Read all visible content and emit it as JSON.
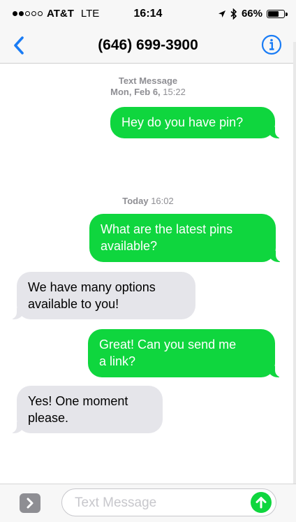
{
  "status_bar": {
    "carrier": "AT&T",
    "network": "LTE",
    "time": "16:14",
    "battery_percent": "66%",
    "battery_level": 0.66,
    "signal_bars_filled": 2,
    "signal_bars_total": 5,
    "icons": [
      "location-arrow-icon",
      "bluetooth-icon",
      "battery-icon"
    ]
  },
  "nav": {
    "title": "(646) 699-3900",
    "back_icon": "chevron-left-icon",
    "info_icon": "info-icon",
    "accent_color": "#1a7cf5"
  },
  "conversation": {
    "timestamps": [
      {
        "label": "Text Message",
        "date": "Mon, Feb 6,",
        "time": "15:22"
      },
      {
        "label": "Today",
        "time": "16:02"
      }
    ],
    "messages": [
      {
        "direction": "outgoing",
        "text": "Hey do you have pin?"
      },
      {
        "direction": "outgoing",
        "line1": "What are the latest pins",
        "line2": "available?"
      },
      {
        "direction": "incoming",
        "line1": "We have many options",
        "line2": "available to you!"
      },
      {
        "direction": "outgoing",
        "line1": "Great! Can you send me",
        "line2": "a link?"
      },
      {
        "direction": "incoming",
        "line1": "Yes! One moment",
        "line2": "please."
      }
    ],
    "outgoing_color": "#0fd63e",
    "incoming_color": "#e5e5ea"
  },
  "composer": {
    "placeholder": "Text Message",
    "expand_icon": "chevron-right-icon",
    "send_icon": "arrow-up-icon"
  }
}
